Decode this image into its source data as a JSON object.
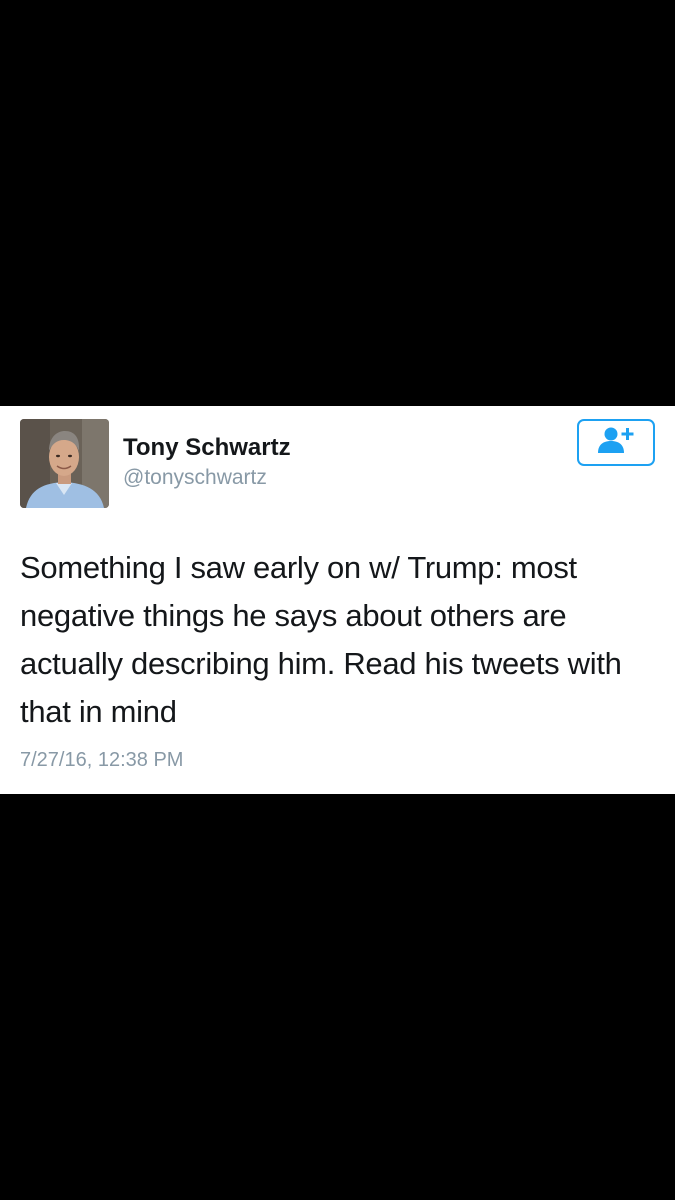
{
  "tweet": {
    "author_name": "Tony Schwartz",
    "author_handle": "@tonyschwartz",
    "text": "Something I saw early on w/ Trump: most negative things he says about others are actually describing him. Read his tweets with that in mind",
    "timestamp": "7/27/16, 12:38 PM"
  },
  "icons": {
    "follow": "add-user-icon",
    "avatar": "profile-photo"
  },
  "colors": {
    "accent": "#1da1f2",
    "text": "#14171a",
    "secondary": "#8899a6",
    "background": "#000000",
    "card": "#ffffff"
  }
}
